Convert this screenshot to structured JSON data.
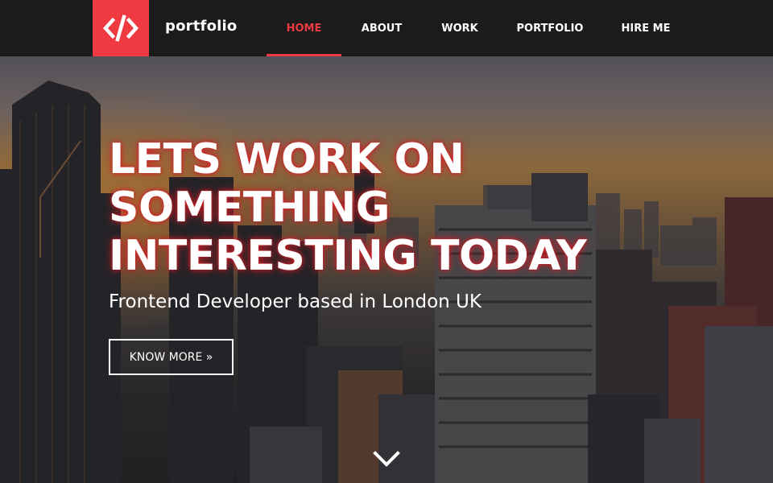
{
  "brand": {
    "logo_icon": "code-brackets-icon",
    "name": "portfolio",
    "accent_color": "#ee3a40"
  },
  "nav": {
    "items": [
      {
        "label": "HOME",
        "active": true
      },
      {
        "label": "ABOUT",
        "active": false
      },
      {
        "label": "WORK",
        "active": false
      },
      {
        "label": "PORTFOLIO",
        "active": false
      },
      {
        "label": "HIRE ME",
        "active": false
      }
    ]
  },
  "hero": {
    "headline_lines": [
      "LETS WORK ON",
      "SOMETHING",
      "INTERESTING TODAY"
    ],
    "subtitle": "Frontend Developer based in London UK",
    "cta_label": "KNOW MORE »",
    "scroll_icon": "chevron-down-icon",
    "background": "city-skyline-sunset"
  }
}
